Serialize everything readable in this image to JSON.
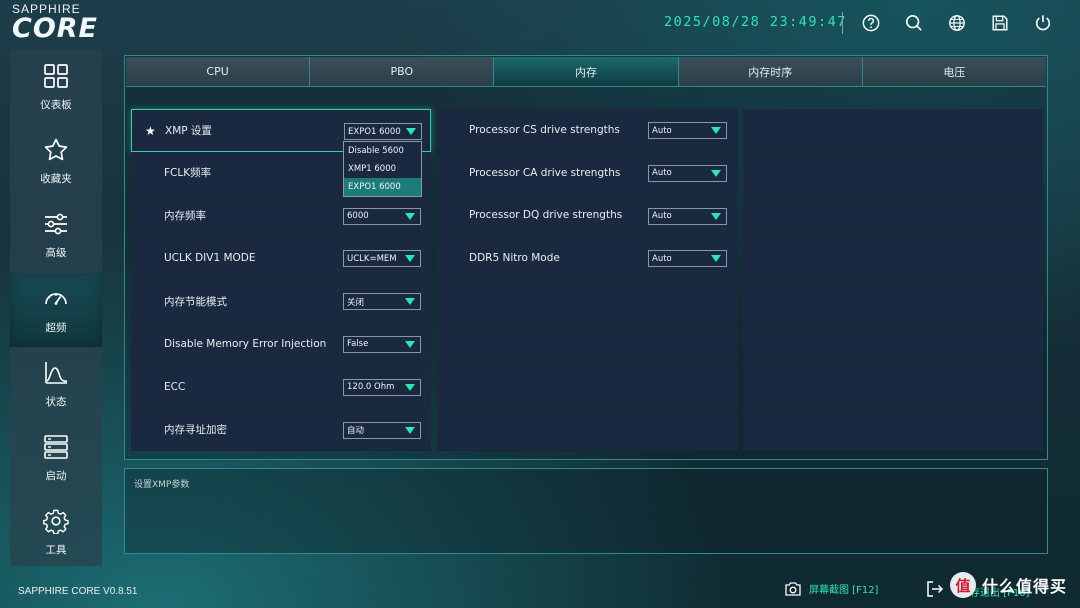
{
  "brand": {
    "top": "SAPPHIRE",
    "core": "CORE"
  },
  "datetime": "2025/08/28 23:49:47",
  "top_icons": [
    "help-icon",
    "search-icon",
    "globe-icon",
    "save-icon",
    "power-icon"
  ],
  "sidebar": {
    "items": [
      {
        "label": "仪表板",
        "icon": "dashboard-icon"
      },
      {
        "label": "收藏夹",
        "icon": "star-icon"
      },
      {
        "label": "高级",
        "icon": "sliders-icon"
      },
      {
        "label": "超频",
        "icon": "gauge-icon",
        "active": true
      },
      {
        "label": "状态",
        "icon": "chart-icon"
      },
      {
        "label": "启动",
        "icon": "boot-icon"
      },
      {
        "label": "工具",
        "icon": "gear-icon"
      }
    ]
  },
  "tabs": [
    "CPU",
    "PBO",
    "内存",
    "内存时序",
    "电压"
  ],
  "active_tab": "内存",
  "left_settings": [
    {
      "label": "XMP 设置",
      "value": "EXPO1 6000",
      "starred": true
    },
    {
      "label": "FCLK频率",
      "value": ""
    },
    {
      "label": "内存频率",
      "value": "6000"
    },
    {
      "label": "UCLK DIV1 MODE",
      "value": "UCLK=MEM"
    },
    {
      "label": "内存节能模式",
      "value": "关闭"
    },
    {
      "label": "Disable Memory Error Injection",
      "value": "False"
    },
    {
      "label": "ECC",
      "value": "120.0 Ohm"
    },
    {
      "label": "内存寻址加密",
      "value": "自动"
    }
  ],
  "xmp_menu": [
    "Disable 5600",
    "XMP1 6000",
    "EXPO1 6000"
  ],
  "xmp_menu_selected": "EXPO1 6000",
  "mid_settings": [
    {
      "label": "Processor CS drive strengths",
      "value": "Auto"
    },
    {
      "label": "Processor CA drive strengths",
      "value": "Auto"
    },
    {
      "label": "Processor DQ drive strengths",
      "value": "Auto"
    },
    {
      "label": "DDR5 Nitro Mode",
      "value": "Auto"
    }
  ],
  "description": "设置XMP参数",
  "footer": {
    "version": "SAPPHIRE CORE V0.8.51",
    "screenshot": "屏幕截图 [F12]",
    "exit_text": "保存退出 [F10]"
  },
  "watermark": {
    "badge": "值",
    "text": "什么值得买"
  },
  "colors": {
    "accent": "#2ee6b0",
    "border": "#2f8a8f",
    "row_bg": "#1a2940"
  }
}
